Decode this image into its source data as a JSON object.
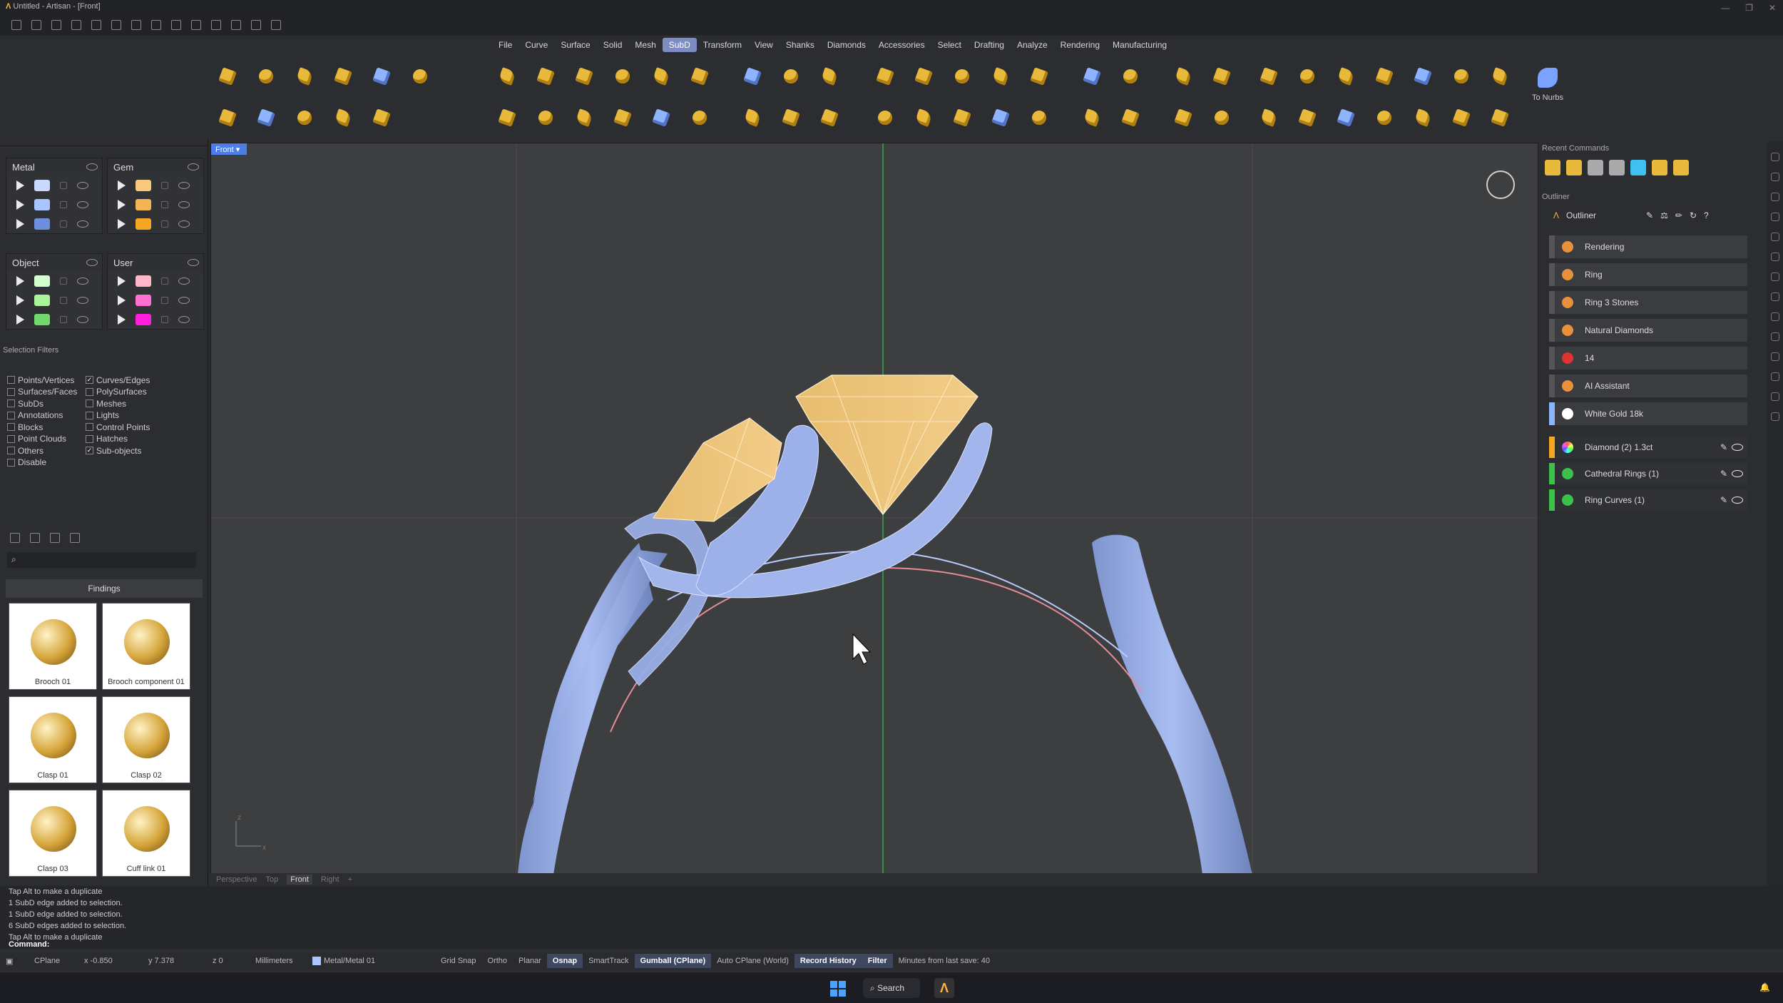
{
  "window": {
    "title": "Untitled - Artisan - [Front]"
  },
  "menu": [
    "File",
    "Curve",
    "Surface",
    "Solid",
    "Mesh",
    "SubD",
    "Transform",
    "View",
    "Shanks",
    "Diamonds",
    "Accessories",
    "Select",
    "Drafting",
    "Analyze",
    "Rendering",
    "Manufacturing"
  ],
  "menu_active": "SubD",
  "ribbon": {
    "to_nurbs_label": "To Nurbs"
  },
  "layers": {
    "metal": {
      "title": "Metal",
      "colors": [
        "#c9d8ff",
        "#a9c4ff",
        "#6f8ee0"
      ]
    },
    "gem": {
      "title": "Gem",
      "colors": [
        "#f7c97a",
        "#f2b455",
        "#f5a623"
      ]
    },
    "object": {
      "title": "Object",
      "colors": [
        "#d4ffd0",
        "#a9f59a",
        "#6fd96b"
      ]
    },
    "user": {
      "title": "User",
      "colors": [
        "#ffb6c8",
        "#ff6fd4",
        "#ff1de0"
      ]
    }
  },
  "selection_filters": {
    "title": "Selection Filters",
    "items": [
      {
        "label": "Points/Vertices",
        "checked": false
      },
      {
        "label": "Curves/Edges",
        "checked": true
      },
      {
        "label": "Surfaces/Faces",
        "checked": false
      },
      {
        "label": "PolySurfaces",
        "checked": false
      },
      {
        "label": "SubDs",
        "checked": false
      },
      {
        "label": "Meshes",
        "checked": false
      },
      {
        "label": "Annotations",
        "checked": false
      },
      {
        "label": "Lights",
        "checked": false
      },
      {
        "label": "Blocks",
        "checked": false
      },
      {
        "label": "Control Points",
        "checked": false
      },
      {
        "label": "Point Clouds",
        "checked": false
      },
      {
        "label": "Hatches",
        "checked": false
      },
      {
        "label": "Others",
        "checked": false
      },
      {
        "label": "Sub-objects",
        "checked": true
      },
      {
        "label": "Disable",
        "checked": false
      }
    ]
  },
  "findings": {
    "tab": "Findings",
    "items": [
      "Brooch 01",
      "Brooch component 01",
      "Clasp 01",
      "Clasp 02",
      "Clasp 03",
      "Cuff link 01"
    ]
  },
  "viewport": {
    "label": "Front",
    "tabs": [
      "Perspective",
      "Top",
      "Front",
      "Right",
      "+"
    ],
    "active_tab": "Front",
    "axis": {
      "z": "z",
      "x": "x"
    }
  },
  "recent_commands": {
    "title": "Recent Commands"
  },
  "outliner": {
    "section_title": "Outliner",
    "tab": "Outliner",
    "rows": [
      {
        "label": "Rendering",
        "bar": "#555"
      },
      {
        "label": "Ring",
        "bar": "#555"
      },
      {
        "label": "Ring 3 Stones",
        "bar": "#555"
      },
      {
        "label": "Natural Diamonds",
        "bar": "#555"
      },
      {
        "label": "14",
        "bar": "#555"
      },
      {
        "label": "AI Assistant",
        "bar": "#555"
      },
      {
        "label": "White Gold 18k",
        "bar": "#8fb4ff"
      }
    ],
    "objects": [
      {
        "label": "Diamond (2) 1.3ct",
        "bar": "#f5a623"
      },
      {
        "label": "Cathedral Rings (1)",
        "bar": "#3cc24a"
      },
      {
        "label": "Ring Curves (1)",
        "bar": "#3cc24a"
      }
    ]
  },
  "command_log": [
    "Tap Alt to make a duplicate",
    "1 SubD edge added to selection.",
    "1 SubD edge added to selection.",
    "6 SubD edges added to selection.",
    "Tap Alt to make a duplicate"
  ],
  "command_prompt": "Command:",
  "status": {
    "cplane": "CPlane",
    "x": "x -0.850",
    "y": "y 7.378",
    "z": "z 0",
    "units": "Millimeters",
    "layer": "Metal/Metal 01",
    "grid_snap": "Grid Snap",
    "ortho": "Ortho",
    "planar": "Planar",
    "osnap": "Osnap",
    "smarttrack": "SmartTrack",
    "gumball": "Gumball (CPlane)",
    "auto_cplane": "Auto CPlane (World)",
    "record_history": "Record History",
    "filter": "Filter",
    "save": "Minutes from last save: 40"
  },
  "taskbar": {
    "search": "Search"
  }
}
